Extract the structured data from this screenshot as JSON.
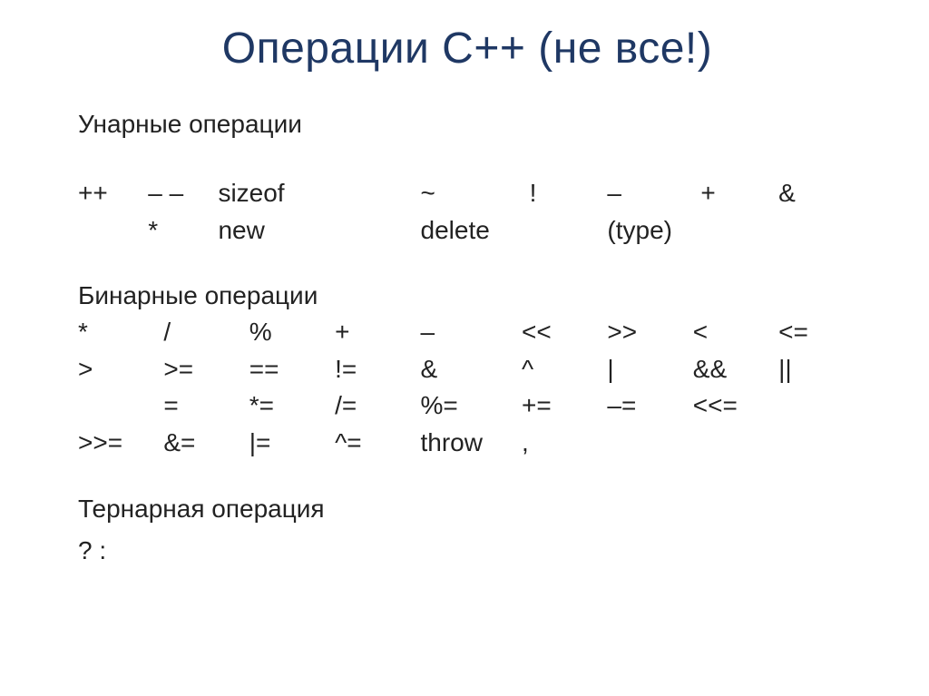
{
  "title": "Операции С++ (не все!)",
  "sections": {
    "unary_label": "Унарные операции",
    "binary_label": "Бинарные операции",
    "ternary_label": "Тернарная операция",
    "ternary_value": "? :"
  },
  "unary": {
    "r0": {
      "c0": "++",
      "c1": "– –",
      "c2": "sizeof",
      "c3": "",
      "c4": "~",
      "c5": "!",
      "c6": "–",
      "c7": "+",
      "c8": "&"
    },
    "r1": {
      "c0": "",
      "c1": "*",
      "c2": "new",
      "c3": "",
      "c4": "delete",
      "c5": "",
      "c6": "(type)",
      "c7": "",
      "c8": ""
    }
  },
  "binary": {
    "r0": {
      "c0": "*",
      "c1": "/",
      "c2": "%",
      "c3": "+",
      "c4": "–",
      "c5": "<<",
      "c6": ">>",
      "c7": "<",
      "c8": "<="
    },
    "r1": {
      "c0": ">",
      "c1": ">=",
      "c2": "==",
      "c3": "!=",
      "c4": "&",
      "c5": "^",
      "c6": "|",
      "c7": "&&",
      "c8": "||"
    },
    "r2": {
      "c0": "",
      "c1": "=",
      "c2": "*=",
      "c3": "/=",
      "c4": "%=",
      "c5": "+=",
      "c6": "–=",
      "c7": "<<=",
      "c8": ""
    },
    "r3": {
      "c0": ">>=",
      "c1": "&=",
      "c2": "|=",
      "c3": "^=",
      "c4": "throw",
      "c5": ",",
      "c6": "",
      "c7": "",
      "c8": ""
    }
  }
}
